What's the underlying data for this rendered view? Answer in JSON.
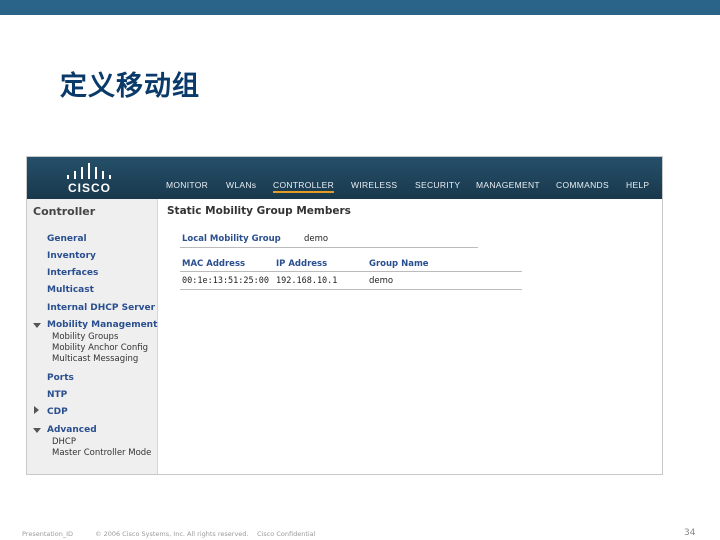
{
  "slide": {
    "title": "定义移动组",
    "footer": {
      "presentation": "Presentation_ID",
      "copyright": "© 2006 Cisco Systems, Inc. All rights reserved.",
      "confidential": "Cisco Confidential",
      "page_number": "34"
    }
  },
  "app": {
    "logo_text": "CISCO",
    "nav": [
      {
        "label": "MONITOR"
      },
      {
        "label": "WLANs"
      },
      {
        "label": "CONTROLLER",
        "active": true
      },
      {
        "label": "WIRELESS"
      },
      {
        "label": "SECURITY"
      },
      {
        "label": "MANAGEMENT"
      },
      {
        "label": "COMMANDS"
      },
      {
        "label": "HELP"
      }
    ],
    "sidebar": {
      "title": "Controller",
      "items": [
        {
          "label": "General"
        },
        {
          "label": "Inventory"
        },
        {
          "label": "Interfaces"
        },
        {
          "label": "Multicast"
        },
        {
          "label": "Internal DHCP Server"
        },
        {
          "label": "Mobility Management"
        },
        {
          "label": "Mobility Groups"
        },
        {
          "label": "Mobility Anchor Config"
        },
        {
          "label": "Multicast Messaging"
        },
        {
          "label": "Ports"
        },
        {
          "label": "NTP"
        },
        {
          "label": "CDP"
        },
        {
          "label": "Advanced"
        },
        {
          "label": "DHCP"
        },
        {
          "label": "Master Controller Mode"
        }
      ]
    },
    "content": {
      "title": "Static Mobility Group Members",
      "local_mobility_group_label": "Local Mobility Group",
      "local_mobility_group_value": "demo",
      "columns": [
        "MAC Address",
        "IP Address",
        "Group Name"
      ],
      "rows": [
        [
          "00:1e:13:51:25:00",
          "192.168.10.1",
          "demo"
        ]
      ]
    }
  },
  "colors": {
    "topbar": "#2b6489",
    "title": "#0a3a69",
    "header": "#1f4660",
    "active_tab": "#e39b22",
    "link": "#2a4f8f"
  }
}
